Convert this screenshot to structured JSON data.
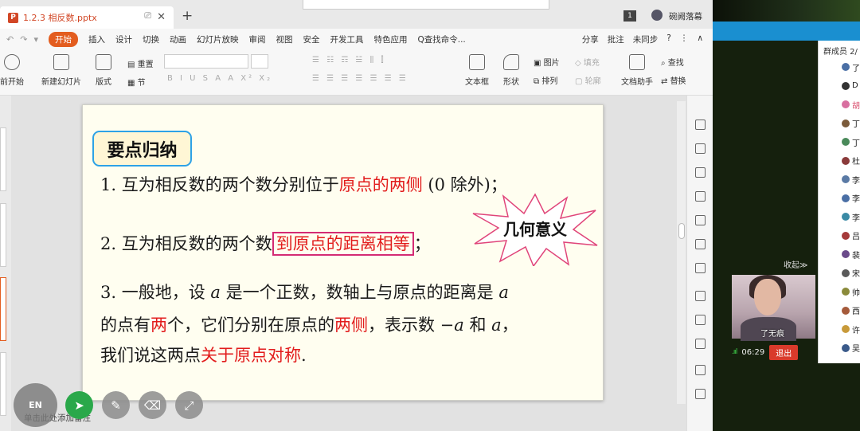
{
  "window": {
    "file_name": "1.2.3 相反数.pptx",
    "ppt_logo": "P",
    "tab_close": "✕",
    "tab_monitor": "⎚",
    "new_tab": "+",
    "page_badge": "1",
    "user_name": "碗阙落幕"
  },
  "menu": {
    "items": [
      "开始",
      "插入",
      "设计",
      "切换",
      "动画",
      "幻灯片放映",
      "审阅",
      "视图",
      "安全",
      "开发工具",
      "特色应用",
      "Q查找命令..."
    ],
    "active": "开始",
    "right": [
      "分享",
      "批注",
      "未同步",
      "?",
      "⋮",
      "∧"
    ]
  },
  "ribbon": {
    "play": "前开始",
    "new_slide": "新建幻灯片",
    "layout": "版式",
    "section": "节",
    "reset": "重置",
    "font_buttons": "B  I  U  S  A  A  X²  X₂",
    "textbox": "文本框",
    "shape": "形状",
    "picture": "图片",
    "arrange": "排列",
    "fill": "填充",
    "outline": "轮廓",
    "doc_helper": "文档助手",
    "find": "查找",
    "replace": "替换"
  },
  "slide": {
    "heading": "要点归纳",
    "line1": {
      "num": "1.",
      "a": "互为相反数的两个数分别位于",
      "b": "原点的两侧",
      "c": " (0 除外)；"
    },
    "line2": {
      "num": "2.",
      "a": "互为相反数的两个数",
      "b": "到原点的距离相等",
      "c": "；"
    },
    "starburst": "几何意义",
    "line3": {
      "num": "3.",
      "a": "一般地，设",
      "var": "a",
      "b": "是一个正数，数轴上与原点的距离是",
      "var2": "a"
    },
    "line4": {
      "a": "的点有",
      "b": "两",
      "c": "个，它们分别在原点的",
      "d": "两侧",
      "e": "，表示数 −",
      "var": "a",
      "f": " 和 ",
      "var2": "a",
      "g": "，"
    },
    "line5": {
      "a": "我们说这两点",
      "b": "关于原点对称",
      "c": "."
    }
  },
  "notes": "单击此处添加备注",
  "floating_toolbar": {
    "en": "EN"
  },
  "meeting": {
    "member_header": "群成员 2/",
    "members": [
      "了",
      "D",
      "胡",
      "丁",
      "丁",
      "杜",
      "李",
      "李",
      "李",
      "吕",
      "裴",
      "宋",
      "帅",
      "西",
      "许",
      "吴"
    ],
    "collapse": "收起≫",
    "video_name": "了无痕",
    "duration": "06:29",
    "signal": ".ııl",
    "exit": "退出"
  },
  "colors": {
    "accent": "#e35d1f",
    "slide_red": "#e21c1c",
    "box_blue": "#2ea2e6",
    "exit_red": "#d93a2b"
  }
}
